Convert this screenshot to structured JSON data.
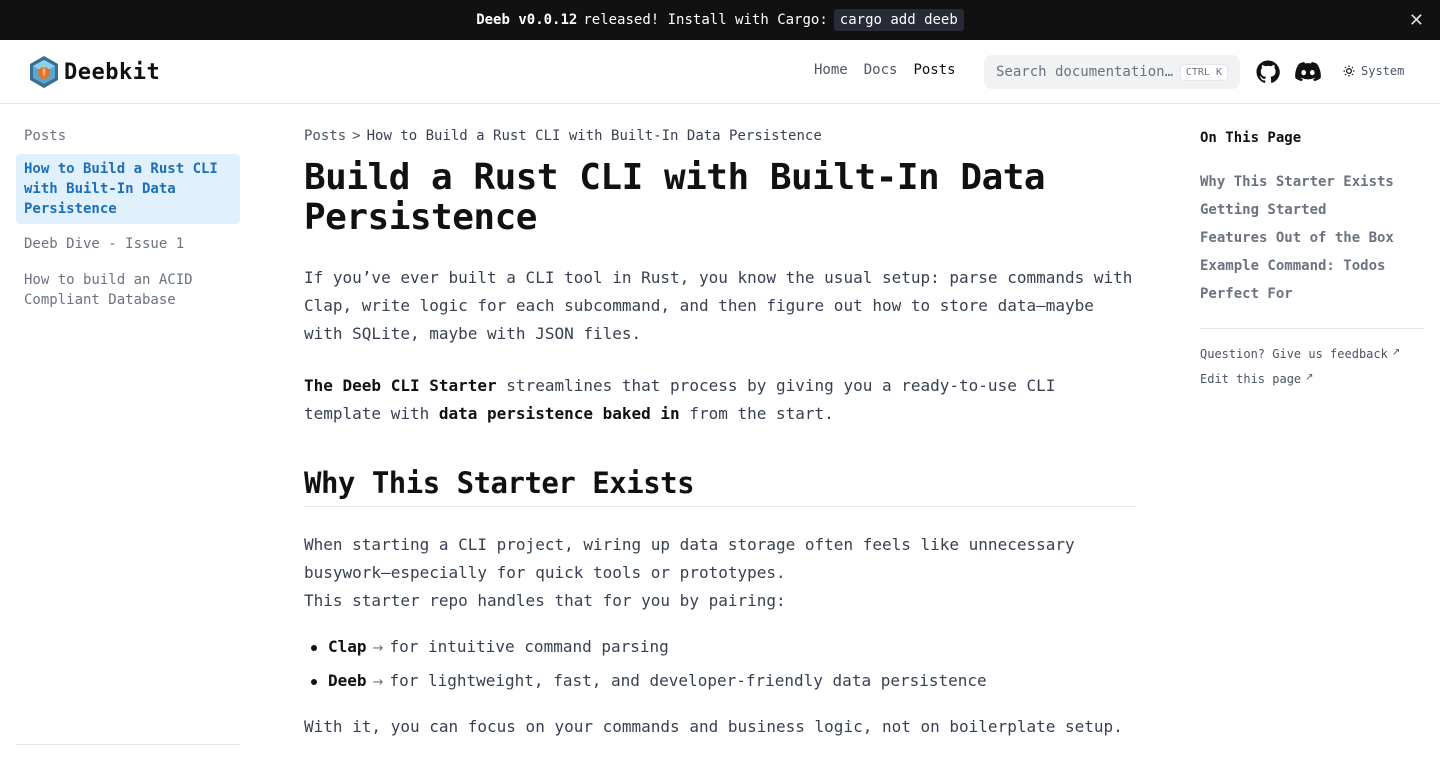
{
  "banner": {
    "product": "Deeb v0.0.12",
    "text": "released! Install with Cargo:",
    "code": "cargo add deeb",
    "close": "✕"
  },
  "header": {
    "logo_text": "Deebkit",
    "nav": [
      "Home",
      "Docs",
      "Posts"
    ],
    "search_placeholder": "Search documentation...",
    "search_kbd": "CTRL K",
    "theme_label": "System"
  },
  "sidebar": {
    "section": "Posts",
    "items": [
      "How to Build a Rust CLI with Built-In Data Persistence",
      "Deeb Dive - Issue 1",
      "How to build an ACID Compliant Database"
    ]
  },
  "breadcrumb": {
    "root": "Posts",
    "sep": ">",
    "current": "How to Build a Rust CLI with Built-In Data Persistence"
  },
  "article": {
    "title": "Build a Rust CLI with Built-In Data Persistence",
    "intro": "If you’ve ever built a CLI tool in Rust, you know the usual setup: parse commands with Clap, write logic for each subcommand, and then figure out how to store data—maybe with SQLite, maybe with JSON files.",
    "p2_bold1": "The Deeb CLI Starter",
    "p2_text1": " streamlines that process by giving you a ready-to-use CLI template with ",
    "p2_bold2": "data persistence baked in",
    "p2_text2": " from the start.",
    "h2": "Why This Starter Exists",
    "p3_line1": "When starting a CLI project, wiring up data storage often feels like unnecessary busywork—especially for quick tools or prototypes.",
    "p3_line2": "This starter repo handles that for you by pairing:",
    "bullets": [
      {
        "bold": "Clap",
        "arrow": "→",
        "text": "for intuitive command parsing"
      },
      {
        "bold": "Deeb",
        "arrow": "→",
        "text": "for lightweight, fast, and developer-friendly data persistence"
      }
    ],
    "p4": "With it, you can focus on your commands and business logic, not on boilerplate setup."
  },
  "toc": {
    "title": "On This Page",
    "links": [
      "Why This Starter Exists",
      "Getting Started",
      "Features Out of the Box",
      "Example Command: Todos",
      "Perfect For"
    ],
    "feedback": "Question? Give us feedback",
    "edit": "Edit this page"
  }
}
